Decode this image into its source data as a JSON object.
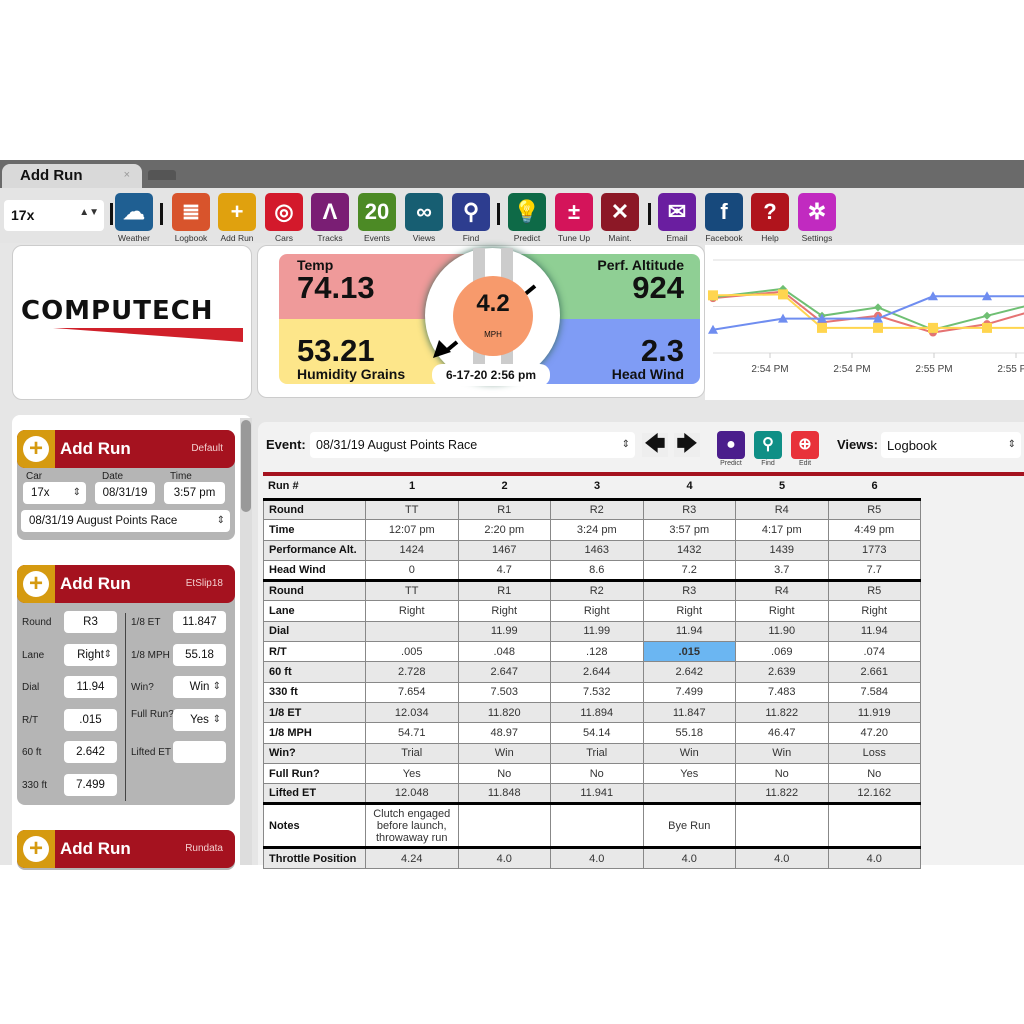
{
  "window": {
    "tab_title": "Add Run",
    "close": "×"
  },
  "toolbar": {
    "car_select": "17x",
    "buttons": [
      {
        "label": "Weather",
        "icon": "weather-icon",
        "color": "#1f5f92",
        "glyph": "☁"
      },
      {
        "label": "Logbook",
        "icon": "logbook-icon",
        "color": "#d8542c",
        "glyph": "≣"
      },
      {
        "label": "Add Run",
        "icon": "add-run-icon",
        "color": "#e0a10e",
        "glyph": "+"
      },
      {
        "label": "Cars",
        "icon": "steering-wheel-icon",
        "color": "#d3192b",
        "glyph": "◎"
      },
      {
        "label": "Tracks",
        "icon": "tracks-icon",
        "color": "#7a1e74",
        "glyph": "Λ"
      },
      {
        "label": "Events",
        "icon": "calendar-icon",
        "color": "#4c8a25",
        "glyph": "20"
      },
      {
        "label": "Views",
        "icon": "glasses-icon",
        "color": "#175e72",
        "glyph": "∞"
      },
      {
        "label": "Find",
        "icon": "search-icon",
        "color": "#2d3d8f",
        "glyph": "⚲"
      },
      {
        "label": "Predict",
        "icon": "lightbulb-icon",
        "color": "#0e6a47",
        "glyph": "💡"
      },
      {
        "label": "Tune Up",
        "icon": "calculator-icon",
        "color": "#d4145a",
        "glyph": "±"
      },
      {
        "label": "Maint.",
        "icon": "tools-icon",
        "color": "#8c1826",
        "glyph": "✕"
      },
      {
        "label": "Email",
        "icon": "email-icon",
        "color": "#6a1ea0",
        "glyph": "✉"
      },
      {
        "label": "Facebook",
        "icon": "facebook-icon",
        "color": "#17497c",
        "glyph": "f"
      },
      {
        "label": "Help",
        "icon": "help-icon",
        "color": "#b0141c",
        "glyph": "?"
      },
      {
        "label": "Settings",
        "icon": "settings-icon",
        "color": "#c12ac0",
        "glyph": "✲"
      }
    ]
  },
  "logo": {
    "text": "COMPUTECH"
  },
  "weather": {
    "temp_label": "Temp",
    "temp": "74.13",
    "alt_label": "Perf. Altitude",
    "alt": "924",
    "hum_label": "Humidity Grains",
    "hum": "53.21",
    "wind_label": "Head Wind",
    "wind": "2.3",
    "wind_speed": "4.2",
    "wind_unit": "MPH",
    "timestamp": "6-17-20 2:56 pm",
    "colors": {
      "temp": "#ef9a9a",
      "alt": "#8fcf94",
      "hum": "#fde68a",
      "wind": "#7f9cf5"
    }
  },
  "chart_data": {
    "type": "line",
    "x_tick_labels": [
      "2:54 PM",
      "2:54 PM",
      "2:55 PM",
      "2:55 PM"
    ],
    "ylim": [
      0,
      100
    ],
    "grid": true,
    "series": [
      {
        "color": "#e57373",
        "marker": "circle",
        "values": [
          59,
          66,
          33,
          40,
          22,
          31,
          46
        ]
      },
      {
        "color": "#6fbf73",
        "marker": "diamond",
        "values": [
          60,
          69,
          40,
          49,
          25,
          40,
          53
        ]
      },
      {
        "color": "#ffd54f",
        "marker": "square",
        "values": [
          62,
          63,
          27,
          27,
          27,
          27,
          27
        ]
      },
      {
        "color": "#6f8df0",
        "marker": "triangle",
        "values": [
          25,
          37,
          37,
          37,
          61,
          61,
          61
        ]
      }
    ]
  },
  "sidebar": {
    "card1": {
      "title": "Add Run",
      "tag": "Default",
      "car_label": "Car",
      "car": "17x",
      "date_label": "Date",
      "date": "08/31/19",
      "time_label": "Time",
      "time": "3:57 pm",
      "event": "08/31/19 August Points Race"
    },
    "card2": {
      "title": "Add Run",
      "tag": "EtSlip18",
      "left": [
        {
          "label": "Round",
          "value": "R3"
        },
        {
          "label": "Lane",
          "value": "Right",
          "select": true
        },
        {
          "label": "Dial",
          "value": "11.94"
        },
        {
          "label": "R/T",
          "value": ".015"
        },
        {
          "label": "60 ft",
          "value": "2.642"
        },
        {
          "label": "330 ft",
          "value": "7.499"
        }
      ],
      "right": [
        {
          "label": "1/8 ET",
          "value": "11.847"
        },
        {
          "label": "1/8 MPH",
          "value": "55.18"
        },
        {
          "label": "Win?",
          "value": "Win",
          "select": true
        },
        {
          "label": "Full Run?",
          "value": "Yes",
          "select": true
        },
        {
          "label": "Lifted ET",
          "value": ""
        }
      ]
    },
    "card3": {
      "title": "Add Run",
      "tag": "Rundata"
    }
  },
  "event_bar": {
    "event_label": "Event:",
    "event": "08/31/19 August Points Race",
    "prev": "🡄",
    "next": "🡆",
    "predict": "Predict",
    "find": "Find",
    "edit": "Edit",
    "views_label": "Views:",
    "view": "Logbook"
  },
  "table": {
    "run_header": "Run #",
    "runs": [
      "1",
      "2",
      "3",
      "4",
      "5",
      "6"
    ],
    "block1": [
      [
        "Round",
        "TT",
        "R1",
        "R2",
        "R3",
        "R4",
        "R5"
      ],
      [
        "Time",
        "12:07 pm",
        "2:20 pm",
        "3:24 pm",
        "3:57 pm",
        "4:17 pm",
        "4:49 pm"
      ],
      [
        "Performance Alt.",
        "1424",
        "1467",
        "1463",
        "1432",
        "1439",
        "1773"
      ],
      [
        "Head Wind",
        "0",
        "4.7",
        "8.6",
        "7.2",
        "3.7",
        "7.7"
      ]
    ],
    "block2": [
      [
        "Round",
        "TT",
        "R1",
        "R2",
        "R3",
        "R4",
        "R5"
      ],
      [
        "Lane",
        "Right",
        "Right",
        "Right",
        "Right",
        "Right",
        "Right"
      ],
      [
        "Dial",
        "",
        "11.99",
        "11.99",
        "11.94",
        "11.90",
        "11.94"
      ],
      [
        "R/T",
        ".005",
        ".048",
        ".128",
        ".015",
        ".069",
        ".074"
      ],
      [
        "60 ft",
        "2.728",
        "2.647",
        "2.644",
        "2.642",
        "2.639",
        "2.661"
      ],
      [
        "330 ft",
        "7.654",
        "7.503",
        "7.532",
        "7.499",
        "7.483",
        "7.584"
      ],
      [
        "1/8 ET",
        "12.034",
        "11.820",
        "11.894",
        "11.847",
        "11.822",
        "11.919"
      ],
      [
        "1/8 MPH",
        "54.71",
        "48.97",
        "54.14",
        "55.18",
        "46.47",
        "47.20"
      ],
      [
        "Win?",
        "Trial",
        "Win",
        "Trial",
        "Win",
        "Win",
        "Loss"
      ],
      [
        "Full Run?",
        "Yes",
        "No",
        "No",
        "Yes",
        "No",
        "No"
      ],
      [
        "Lifted ET",
        "12.048",
        "11.848",
        "11.941",
        "",
        "11.822",
        "12.162"
      ]
    ],
    "notes": [
      "Notes",
      "Clutch engaged before launch, throwaway run",
      "",
      "",
      "Bye Run",
      "",
      ""
    ],
    "throttle": [
      "Throttle Position",
      "4.24",
      "4.0",
      "4.0",
      "4.0",
      "4.0",
      "4.0"
    ]
  }
}
